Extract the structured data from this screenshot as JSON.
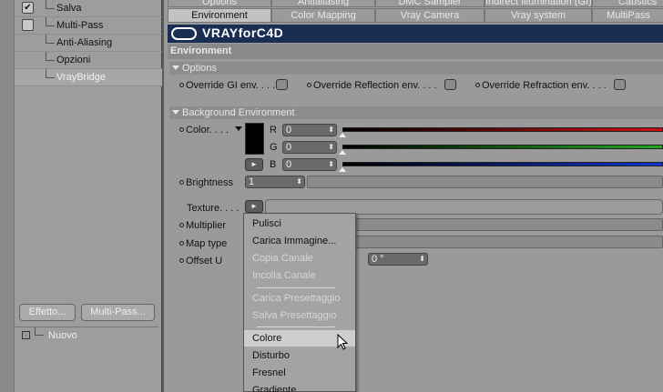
{
  "left_panel": {
    "items": [
      {
        "label": "Salva",
        "checked": true
      },
      {
        "label": "Multi-Pass",
        "checked": false
      },
      {
        "label": "Anti-Aliasing"
      },
      {
        "label": "Opzioni"
      },
      {
        "label": "VrayBridge",
        "selected": true
      }
    ],
    "buttons": {
      "effect": "Effetto...",
      "multipass": "Multi-Pass..."
    },
    "list_item": "Nuovo"
  },
  "tabs_row1": [
    "Options",
    "Antialiasing",
    "DMC Sampler",
    "Indirect Illumination (GI)",
    "Caustics"
  ],
  "tabs_row2": [
    "Environment",
    "Color Mapping",
    "Vray Camera",
    "Vray system",
    "MultiPass"
  ],
  "active_tab": "Environment",
  "banner": {
    "brand": "VRAYforC4D"
  },
  "section_title": "Environment",
  "options": {
    "header": "Options",
    "gi": "Override GI env. . . .",
    "reflection": "Override Reflection env. . . .",
    "refraction": "Override Refraction env. . . ."
  },
  "background": {
    "header": "Background Environment",
    "color_label": "Color. . . .",
    "r_label": "R",
    "r_value": "0",
    "g_label": "G",
    "g_value": "0",
    "b_label": "B",
    "b_value": "0",
    "brightness_label": "Brightness",
    "brightness_value": "1",
    "texture_label": "Texture. . . .",
    "multiplier_label": "Multiplier",
    "maptype_label": "Map type",
    "offset_label": "Offset U",
    "offset_value": "0 °",
    "swatch_color": "#000000"
  },
  "menu": {
    "items": [
      {
        "label": "Pulisci",
        "disabled": false
      },
      {
        "label": "Carica Immagine...",
        "disabled": false
      },
      {
        "label": "Copia Canale",
        "disabled": true
      },
      {
        "label": "Incolla Canale",
        "disabled": true
      },
      {
        "label": "Carica Presettaggio",
        "disabled": true
      },
      {
        "label": "Salva Presettaggio",
        "disabled": true
      },
      {
        "label": "Colore",
        "disabled": false,
        "highlighted": true
      },
      {
        "label": "Disturbo",
        "disabled": false
      },
      {
        "label": "Fresnel",
        "disabled": false
      },
      {
        "label": "Gradiente",
        "disabled": false
      }
    ]
  },
  "colors": {
    "red": "#cc1111",
    "green": "#22aa22",
    "blue": "#1133cc",
    "banner": "#1a2d52"
  }
}
